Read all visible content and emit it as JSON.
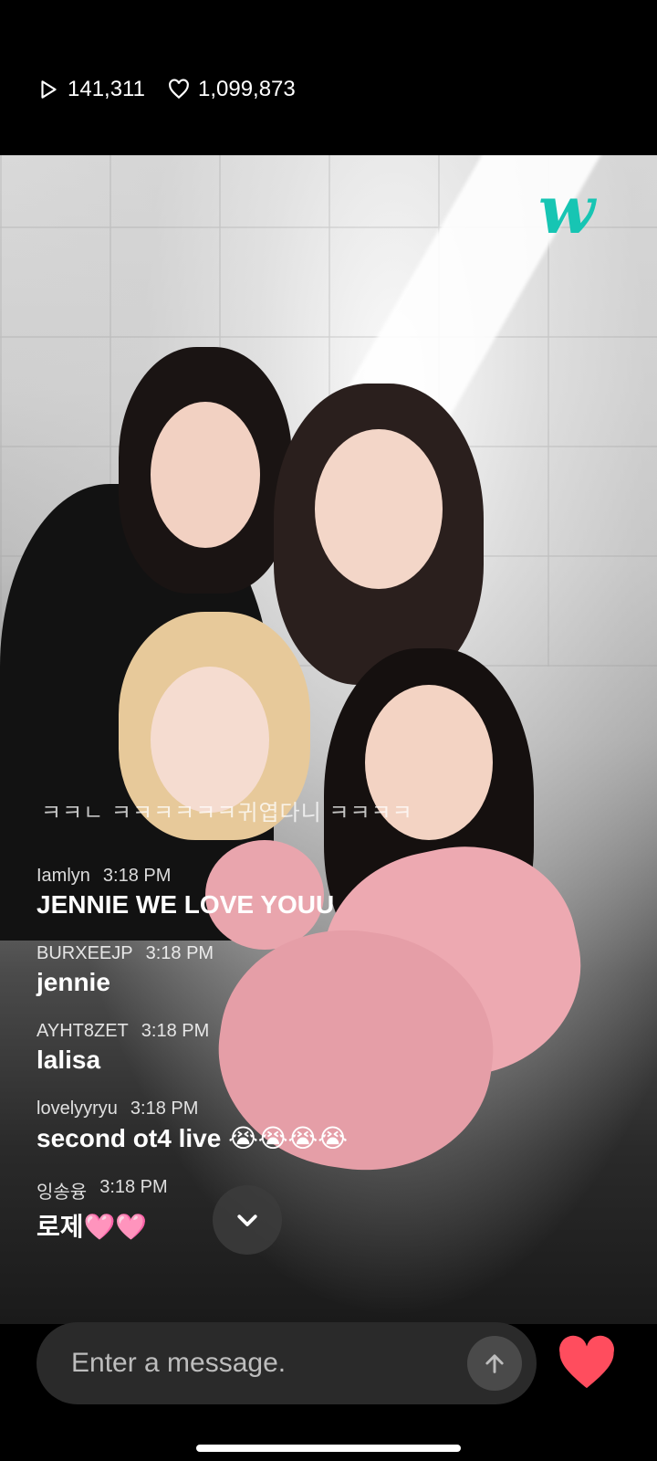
{
  "stats": {
    "views": "141,311",
    "likes": "1,099,873",
    "views_icon": "play-icon",
    "likes_icon": "heart-outline-icon"
  },
  "overlay": {
    "logo": "w",
    "logo_color": "#17c5b3",
    "ticker": "ㅋㅋㄴ ㅋㅋㅋㅋㅋㅋ귀엽다니 ㅋㅋㅋㅋ"
  },
  "chat": {
    "messages": [
      {
        "user": "Iamlyn",
        "time": "3:18 PM",
        "text": "JENNIE WE LOVE YOUU"
      },
      {
        "user": "BURXEEJP",
        "time": "3:18 PM",
        "text": "jennie"
      },
      {
        "user": "AYHT8ZET",
        "time": "3:18 PM",
        "text": "lalisa"
      },
      {
        "user": "lovelyyryu",
        "time": "3:18 PM",
        "text": "second ot4 live 😭😭😭😭"
      },
      {
        "user": "잉송융",
        "time": "3:18 PM",
        "text": "로제🩷🩷"
      }
    ]
  },
  "composer": {
    "placeholder": "Enter a message.",
    "send_icon": "arrow-up-icon",
    "like_icon": "heart-filled-icon",
    "like_color": "#ff4d5e"
  }
}
